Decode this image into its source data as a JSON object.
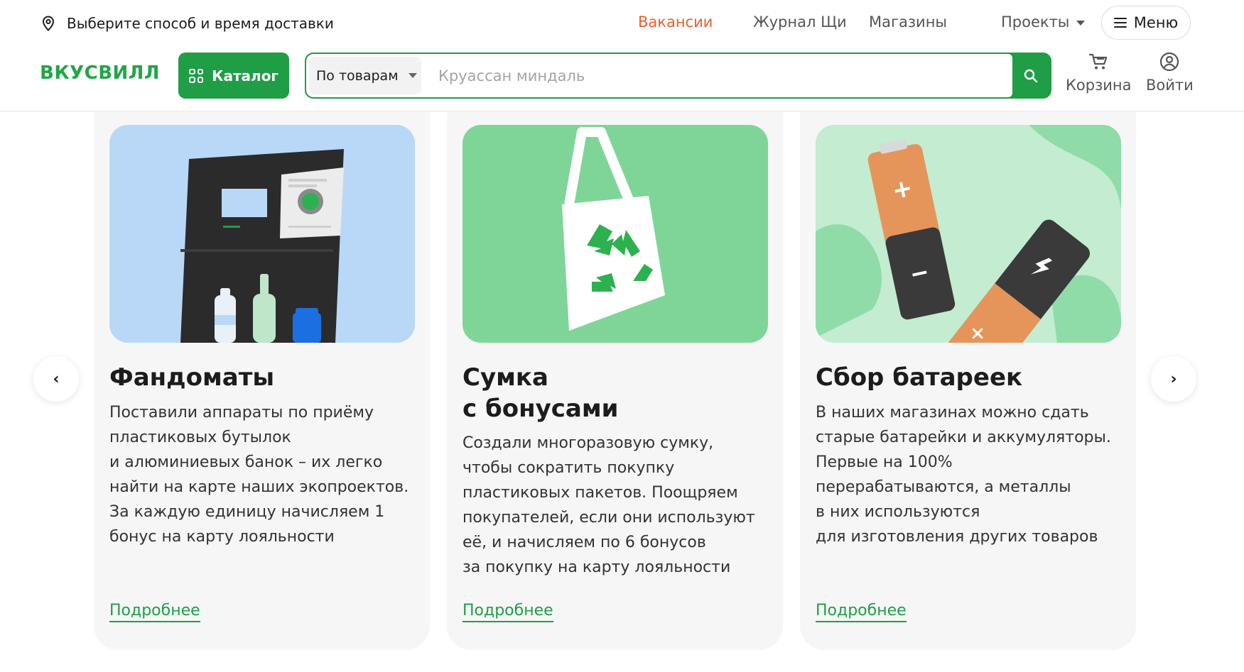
{
  "header": {
    "delivery_text": "Выберите способ и время доставки",
    "nav": {
      "vacancies": "Вакансии",
      "journal": "Журнал Щи",
      "stores": "Магазины",
      "projects": "Проекты"
    },
    "menu_label": "Меню",
    "logo": "ВКУСВИЛЛ",
    "catalog_label": "Каталог",
    "search": {
      "scope": "По товарам",
      "placeholder": "Круассан миндаль",
      "value": ""
    },
    "cart_label": "Корзина",
    "login_label": "Войти"
  },
  "colors": {
    "brand_green": "#1f9e46",
    "accent_orange": "#e8602c",
    "card_bg": "#f6f6f7"
  },
  "cards": [
    {
      "title": "Фандоматы",
      "text": "Поставили аппараты по приёму\nпластиковых бутылок\nи алюминиевых банок – их легко\nнайти на карте наших экопроектов.\nЗа каждую единицу начисляем 1\nбонус на карту лояльности",
      "link": "Подробнее"
    },
    {
      "title": "Сумка\nс бонусами",
      "text": "Создали многоразовую сумку,\nчтобы сократить покупку\nпластиковых пакетов. Поощряем\nпокупателей, если они используют\nеё, и начисляем по 6 бонусов\nза покупку на карту лояльности",
      "link": "Подробнее"
    },
    {
      "title": "Сбор батареек",
      "text": "В наших магазинах можно сдать\nстарые батарейки и аккумуляторы.\nПервые на 100%\nперерабатываются, а металлы\nв них используются\nдля изготовления других товаров",
      "link": "Подробнее"
    }
  ],
  "icons": {
    "location": "location-pin-icon",
    "menu": "hamburger-icon",
    "catalog": "grid-icon",
    "search": "magnifier-icon",
    "cart": "cart-icon",
    "login": "user-circle-icon",
    "prev": "chevron-left-icon",
    "next": "chevron-right-icon"
  },
  "arrows": {
    "prev": "‹",
    "next": "›"
  }
}
